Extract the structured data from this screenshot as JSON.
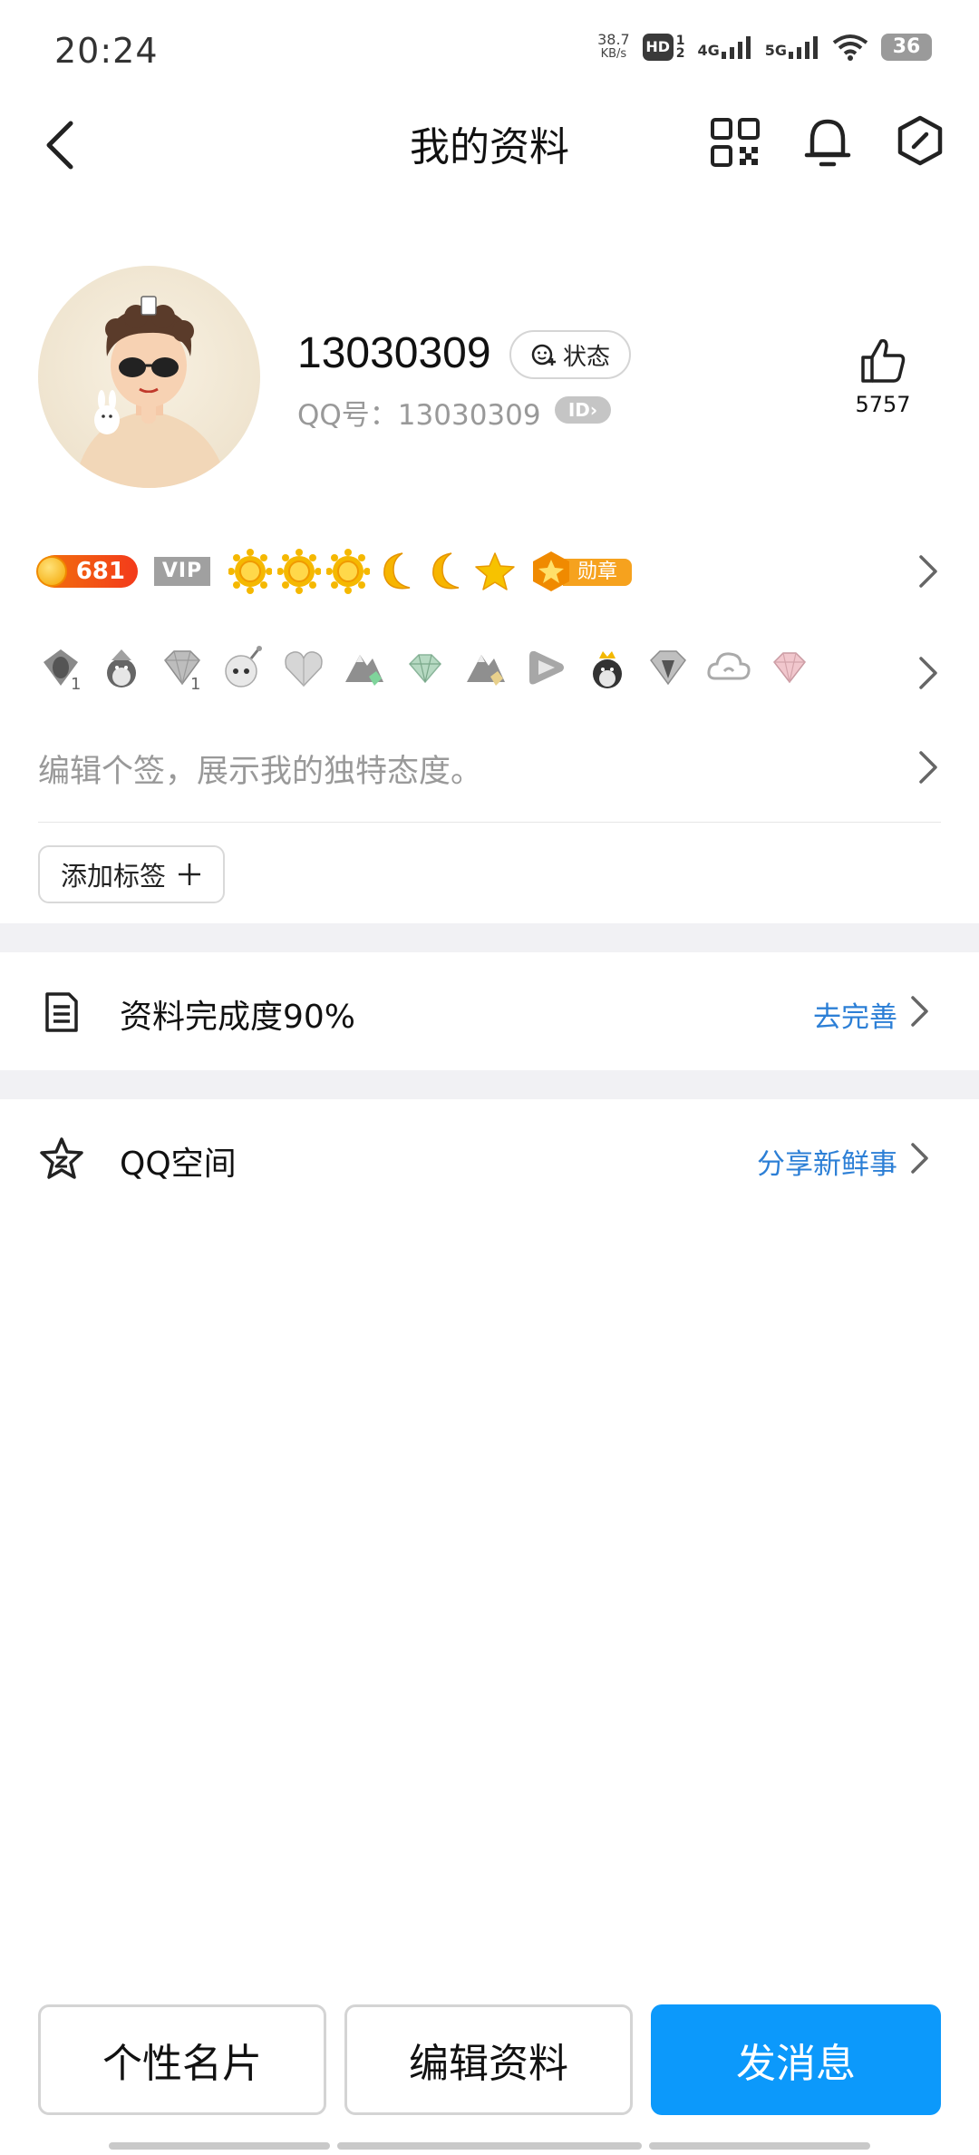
{
  "status_bar": {
    "time": "20:24",
    "net_speed_value": "38.7",
    "net_speed_unit": "KB/s",
    "hd_label": "HD",
    "sim_slots": "1\n2",
    "net_gen_1": "4G",
    "net_gen_2": "5G",
    "battery": "36"
  },
  "nav": {
    "title": "我的资料",
    "icons": [
      "back-icon",
      "qr-code-icon",
      "bell-icon",
      "settings-hex-icon"
    ]
  },
  "profile": {
    "nickname": "13030309",
    "status_label": "状态",
    "qq_number_text": "QQ号：13030309",
    "id_badge": "ID",
    "like_count": "5757"
  },
  "badges": {
    "level_number": "681",
    "vip_label": "VIP",
    "level_icons": [
      "sun",
      "sun",
      "sun",
      "moon",
      "moon",
      "star"
    ],
    "medal_label": "勋章",
    "gray_icons": [
      "penguin-v",
      "penguin-hat",
      "diamond-1",
      "bomb",
      "heart",
      "mountain",
      "gem",
      "mountain-gold",
      "play",
      "penguin-crown",
      "diamond",
      "cloud",
      "pink-gem"
    ]
  },
  "signature_placeholder": "编辑个签，展示我的独特态度。",
  "add_tag_label": "添加标签",
  "completeness": {
    "label": "资料完成度90%",
    "action": "去完善"
  },
  "qzone": {
    "label": "QQ空间",
    "action": "分享新鲜事"
  },
  "buttons": {
    "card": "个性名片",
    "edit": "编辑资料",
    "message": "发消息"
  },
  "colors": {
    "primary_button": "#0c99fb",
    "action_link": "#2c7fd6",
    "level_pill": "#f33a1b"
  }
}
